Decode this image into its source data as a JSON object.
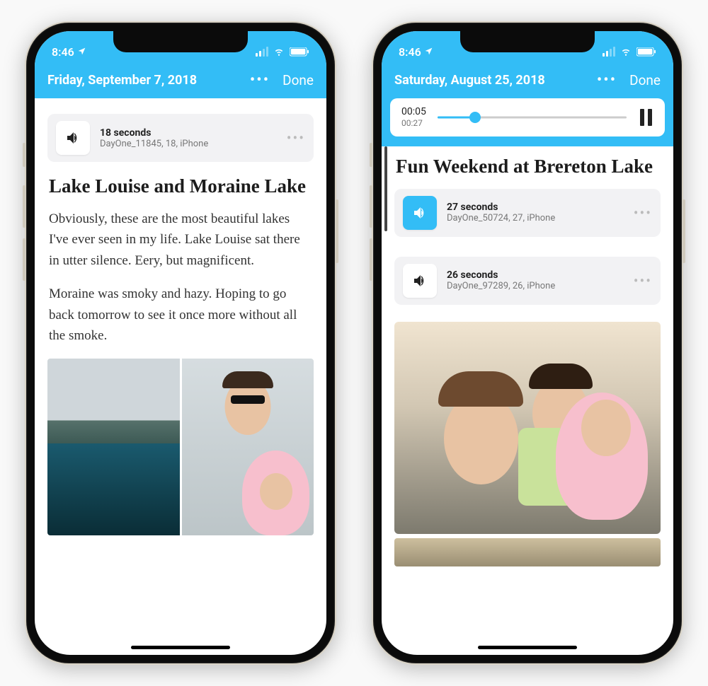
{
  "status": {
    "time": "8:46"
  },
  "phones": [
    {
      "date": "Friday, September 7, 2018",
      "done": "Done",
      "audio": {
        "duration": "18 seconds",
        "meta": "DayOne_11845, 18, iPhone"
      },
      "title": "Lake Louise and Moraine Lake",
      "p1": "Obviously, these are the most beautiful lakes I've ever seen in my life. Lake Louise sat there in utter silence. Eery, but magnificent.",
      "p2": "Moraine was smoky and hazy. Hoping to go back tomorrow to see it once more without all the smoke."
    },
    {
      "date": "Saturday, August 25, 2018",
      "done": "Done",
      "player": {
        "elapsed": "00:05",
        "total": "00:27",
        "progress_pct": 20
      },
      "title": "Fun Weekend at Brereton Lake",
      "audio1": {
        "duration": "27 seconds",
        "meta": "DayOne_50724, 27, iPhone"
      },
      "audio2": {
        "duration": "26 seconds",
        "meta": "DayOne_97289, 26, iPhone"
      }
    }
  ]
}
